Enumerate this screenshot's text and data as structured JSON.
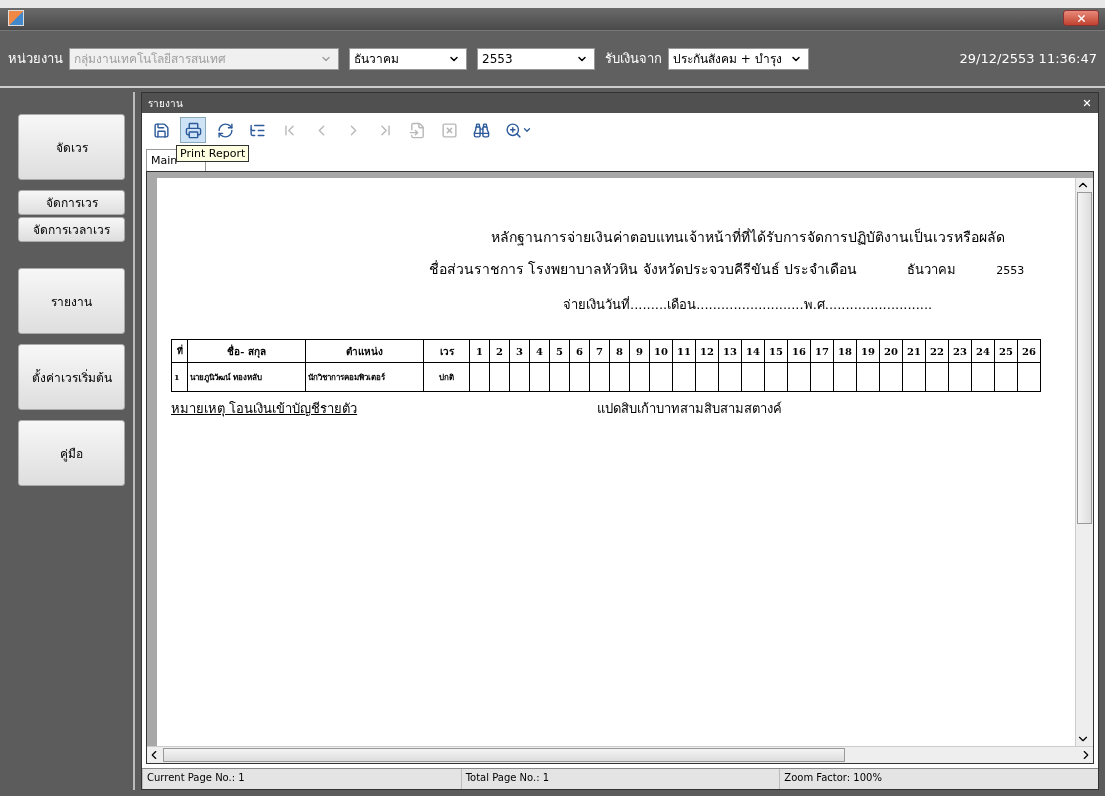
{
  "toolbar": {
    "fields": [
      {
        "kind": "label",
        "text": "หน่วยงาน"
      },
      {
        "kind": "wide_dropdown",
        "value": "กลุ่มงานเทคโนโลยีสารสนเทศ",
        "disabled": true
      },
      {
        "kind": "dropdown",
        "value": "ธันวาคม",
        "disabled": false
      },
      {
        "kind": "dropdown",
        "value": "2553",
        "disabled": false
      },
      {
        "kind": "label",
        "text": "รับเงินจาก"
      },
      {
        "kind": "dropdown",
        "value": "ประกันสังคม + บำรุง",
        "disabled": false
      }
    ],
    "datetime": "29/12/2553 11:36:47"
  },
  "sidebar": {
    "items": [
      {
        "label": "จัดเวร",
        "kind": "large"
      },
      {
        "label": "จัดการเวร",
        "kind": "small"
      },
      {
        "label": "จัดการเวลาเวร",
        "kind": "small"
      },
      {
        "label": "รายงาน",
        "kind": "large"
      },
      {
        "label": "ตั้งค่าเวรเริ่มต้น",
        "kind": "large"
      },
      {
        "label": "คู่มือ",
        "kind": "large"
      }
    ]
  },
  "report_window": {
    "title": "รายงาน",
    "tools": [
      {
        "kind": "export",
        "disabled": false,
        "selected": false
      },
      {
        "kind": "print",
        "disabled": false,
        "selected": true
      },
      {
        "kind": "refresh",
        "disabled": false,
        "selected": false
      },
      {
        "kind": "tree",
        "disabled": false,
        "selected": false
      },
      {
        "kind": "first",
        "disabled": true,
        "selected": false
      },
      {
        "kind": "prev",
        "disabled": true,
        "selected": false
      },
      {
        "kind": "next",
        "disabled": true,
        "selected": false
      },
      {
        "kind": "last",
        "disabled": true,
        "selected": false
      },
      {
        "kind": "goto",
        "disabled": true,
        "selected": false
      },
      {
        "kind": "stop",
        "disabled": true,
        "selected": false
      },
      {
        "kind": "find",
        "disabled": false,
        "selected": false
      },
      {
        "kind": "zoom",
        "disabled": false,
        "selected": false
      }
    ],
    "tooltip": "Print Report",
    "tabs": [
      {
        "label": "Main",
        "selected": true
      }
    ],
    "page": {
      "title": "หลักฐานการจ่ายเงินค่าตอบแทนเจ้าหน้าที่ที่ได้รับการจัดการปฏิบัติงานเป็นเวรหรือผลัด",
      "agency": "ชื่อส่วนราชการ โรงพยาบาลหัวหิน จังหวัดประจวบคีรีขันธ์ ประจำเดือน",
      "month": "ธันวาคม",
      "year": "2553",
      "pay_date": "จ่ายเงินวันที่.........เดือน..........................พ.ศ..........................",
      "table": {
        "columns": [
          "ที่",
          "ชื่อ- สกุล",
          "ตำแหน่ง",
          "เวร",
          "1",
          "2",
          "3",
          "4",
          "5",
          "6",
          "7",
          "8",
          "9",
          "10",
          "11",
          "12",
          "13",
          "14",
          "15",
          "16",
          "17",
          "18",
          "19",
          "20",
          "21",
          "22",
          "23",
          "24",
          "25",
          "26"
        ],
        "rows": [
          [
            "1",
            "นายภูนิวัฒน์ ทองหลับ",
            "นักวิชาการคอมพิวเตอร์",
            "ปกติ"
          ]
        ]
      },
      "note": "หมายเหตุ  โอนเงินเข้าบัญชีรายตัว",
      "amount_words": "แปดสิบเก้าบาทสามสิบสามสตางค์"
    },
    "status_bar": [
      "Current Page No.: 1",
      "Total Page No.: 1",
      "Zoom Factor: 100%"
    ]
  }
}
